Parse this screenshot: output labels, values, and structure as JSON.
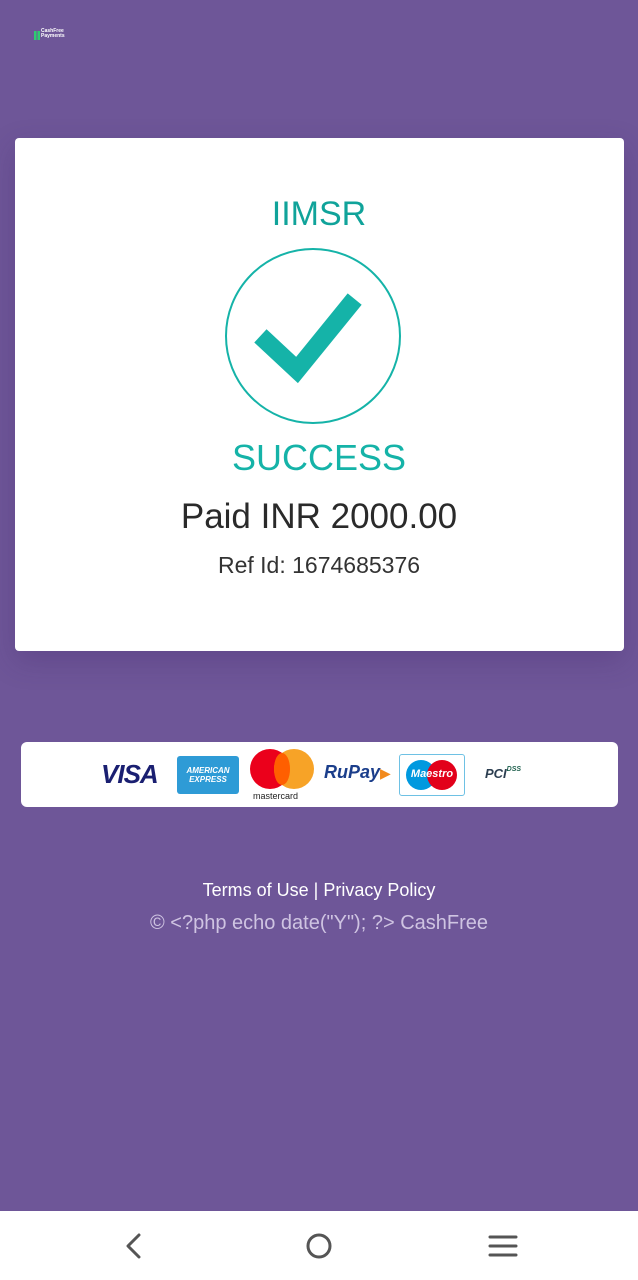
{
  "header": {
    "logo_line1": "CashFree",
    "logo_line2": "Payments"
  },
  "card": {
    "merchant": "IIMSR",
    "status": "SUCCESS",
    "amount": "Paid INR 2000.00",
    "ref": "Ref Id: 1674685376"
  },
  "payment_brands": {
    "visa": "VISA",
    "amex_line1": "AMERICAN",
    "amex_line2": "EXPRESS",
    "mastercard": "mastercard",
    "rupay": "RuPay",
    "maestro": "Maestro",
    "pci": "PCI",
    "pci_dss": "DSS"
  },
  "footer": {
    "terms": "Terms of Use",
    "separator": "|",
    "privacy": "Privacy Policy",
    "copyright": "© <?php echo date(\"Y\"); ?> CashFree"
  },
  "colors": {
    "background": "#6e5698",
    "accent": "#15b3a8"
  },
  "nav_icons": [
    "back-icon",
    "home-icon",
    "menu-icon"
  ]
}
